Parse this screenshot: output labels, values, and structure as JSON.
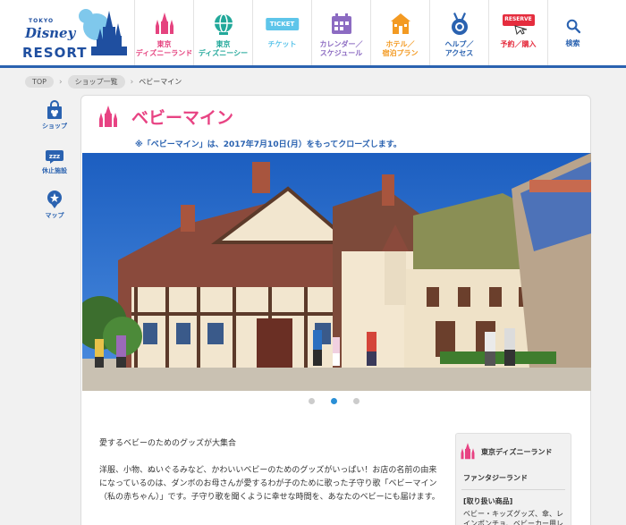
{
  "brand": {
    "tokyo": "TOKYO",
    "disney": "Disney",
    "resort": "RESORT"
  },
  "nav": [
    {
      "label": "東京\nディズニーランド",
      "icon": "castle-icon",
      "color": "#e5437f"
    },
    {
      "label": "東京\nディズニーシー",
      "icon": "globe-icon",
      "color": "#22a89a"
    },
    {
      "label": "チケット",
      "icon": "ticket-icon",
      "color": "#5ec5ea",
      "badge": "TICKET"
    },
    {
      "label": "カレンダー／\nスケジュール",
      "icon": "calendar-icon",
      "color": "#8c6bc2"
    },
    {
      "label": "ホテル／\n宿泊プラン",
      "icon": "hotel-icon",
      "color": "#f39a22"
    },
    {
      "label": "ヘルプ／\nアクセス",
      "icon": "help-medal-icon",
      "color": "#2a62b0"
    },
    {
      "label": "予約／購入",
      "icon": "reserve-icon",
      "color": "#e52d3e",
      "badge": "RESERVE"
    },
    {
      "label": "検索",
      "icon": "search-icon",
      "color": "#2a62b0"
    }
  ],
  "breadcrumb": {
    "top": "TOP",
    "shops": "ショップ一覧",
    "current": "ベビーマイン"
  },
  "side": [
    {
      "label": "ショップ",
      "icon": "shopping-bag-icon"
    },
    {
      "label": "休止施設",
      "icon": "sleep-icon"
    },
    {
      "label": "マップ",
      "icon": "map-pin-icon"
    }
  ],
  "page": {
    "title": "ベビーマイン",
    "notice": "※「ベビーマイン」は、2017年7月10日(月）をもってクローズします。",
    "lead": "愛するベビーのためのグッズが大集合",
    "body": "洋服、小物、ぬいぐるみなど、かわいいベビーのためのグッズがいっぱい！お店の名前の由来になっているのは、ダンボのお母さんが愛するわが子のために歌った子守り歌「ベビーマイン（私の赤ちゃん）」です。子守り歌を聞くように幸せな時間を、あなたのベビーにも届けます。",
    "slides": 3,
    "active_slide": 2
  },
  "info": {
    "park": "東京ディズニーランド",
    "area": "ファンタジーランド",
    "items_heading": "[取り扱い商品]",
    "items": "ベビー・キッズグッズ、傘、レインポンチョ、ベビーカー用レ"
  },
  "colors": {
    "accent": "#2a62b0",
    "pink": "#e84383"
  }
}
